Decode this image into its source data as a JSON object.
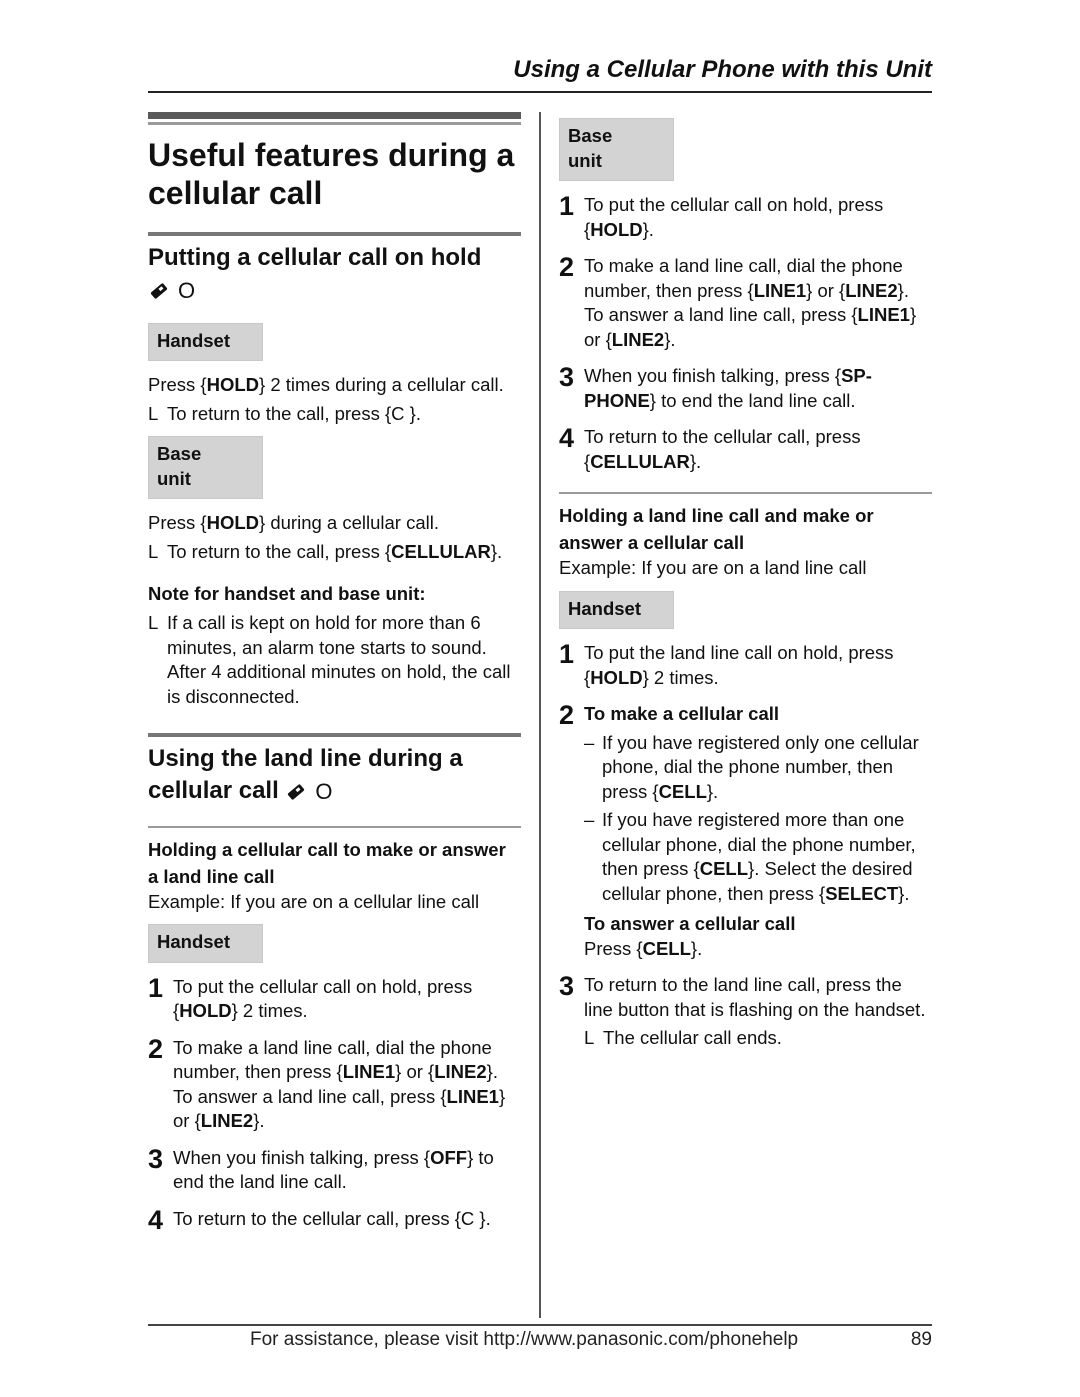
{
  "header": {
    "title": "Using a Cellular Phone with this Unit"
  },
  "footer": {
    "text": "For assistance, please visit http://www.panasonic.com/phonehelp",
    "page_number": "89"
  },
  "left": {
    "title": "Useful features during a cellular call",
    "hold_section": {
      "heading": "Putting a cellular call on hold",
      "mode": "O",
      "handset_label": "Handset",
      "handset_text_pre": "Press {",
      "handset_key": "HOLD",
      "handset_text_post": "} 2 times during a cellular call.",
      "handset_note_mark": "L",
      "handset_note": "To return to the call, press {C   }.",
      "base_label": "Base unit",
      "base_text_pre": "Press {",
      "base_key": "HOLD",
      "base_text_post": "} during a cellular call.",
      "base_note_mark": "L",
      "base_note_pre": "To return to the call, press {",
      "base_note_key": "CELLULAR",
      "base_note_post": "}.",
      "note_heading": "Note for handset and base unit:",
      "note_mark": "L",
      "note_text": "If a call is kept on hold for more than 6 minutes, an alarm tone starts to sound. After 4 additional minutes on hold, the call is disconnected."
    },
    "landline_section": {
      "heading": "Using the land line during a cellular call",
      "mode": "O",
      "sub_heading": "Holding a cellular call to make or answer a land line call",
      "example": "Example: If you are on a cellular line call",
      "handset_label": "Handset",
      "steps": [
        {
          "num": "1",
          "a": "To put the cellular call on hold, press {",
          "k1": "HOLD",
          "b": "} 2 times."
        },
        {
          "num": "2",
          "a": "To make a land line call, dial the phone number, then press {",
          "k1": "LINE1",
          "b": "} or {",
          "k2": "LINE2",
          "c": "}.",
          "d": "To answer a land line call, press {",
          "k3": "LINE1",
          "e": "} or {",
          "k4": "LINE2",
          "f": "}."
        },
        {
          "num": "3",
          "a": "When you finish talking, press {",
          "k1": "OFF",
          "b": "} to end the land line call."
        },
        {
          "num": "4",
          "a": "To return to the cellular call, press {C   }."
        }
      ]
    }
  },
  "right": {
    "base_label": "Base unit",
    "base_steps": [
      {
        "num": "1",
        "a": "To put the cellular call on hold, press {",
        "k1": "HOLD",
        "b": "}."
      },
      {
        "num": "2",
        "a": "To make a land line call, dial the phone number, then press {",
        "k1": "LINE1",
        "b": "} or {",
        "k2": "LINE2",
        "c": "}.",
        "d": "To answer a land line call, press {",
        "k3": "LINE1",
        "e": "} or {",
        "k4": "LINE2",
        "f": "}."
      },
      {
        "num": "3",
        "a": "When you finish talking, press {",
        "k1": "SP-PHONE",
        "b": "} to end the land line call."
      },
      {
        "num": "4",
        "a": "To return to the cellular call, press {",
        "k1": "CELLULAR",
        "b": "}."
      }
    ],
    "sub_heading": "Holding a land line call and make or answer a cellular call",
    "example": "Example: If you are on a land line call",
    "handset_label": "Handset",
    "handset_steps": {
      "s1": {
        "num": "1",
        "a": "To put the land line call on hold, press {",
        "k1": "HOLD",
        "b": "} 2 times."
      },
      "s2": {
        "num": "2",
        "heading": "To make a cellular call",
        "dash1": {
          "mark": "–",
          "a": "If you have registered only one cellular phone, dial the phone number, then press {",
          "k1": "CELL",
          "b": "}."
        },
        "dash2": {
          "mark": "–",
          "a": "If you have registered more than one cellular phone, dial the phone number, then press {",
          "k1": "CELL",
          "b": "}. Select the desired cellular phone, then press {",
          "k2": "SELECT",
          "c": "}."
        },
        "answer_heading": "To answer a cellular call",
        "answer_pre": "Press {",
        "answer_key": "CELL",
        "answer_post": "}."
      },
      "s3": {
        "num": "3",
        "a": "To return to the land line call, press the line button that is flashing on the handset.",
        "note_mark": "L",
        "note": "The cellular call ends."
      }
    }
  }
}
